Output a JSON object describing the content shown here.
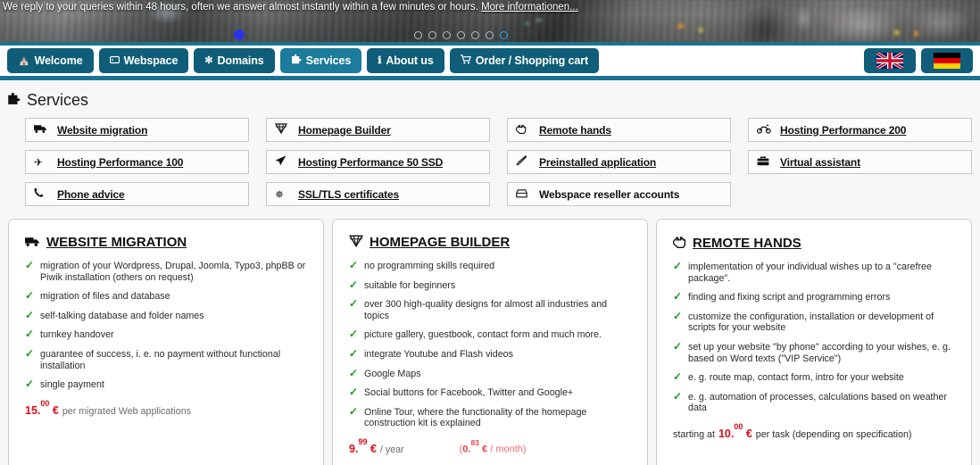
{
  "banner": {
    "message": "We reply to your queries within 48 hours, often we answer almost instantly within a few minutes or hours.",
    "more_link": "More informationen...",
    "carousel": {
      "dot_count": 7,
      "active_index": 6
    }
  },
  "nav": {
    "items": [
      {
        "label": "Welcome",
        "icon": "home-icon",
        "glyph": "⌂",
        "active": false
      },
      {
        "label": "Webspace",
        "icon": "server-icon",
        "glyph": "⛁",
        "active": false
      },
      {
        "label": "Domains",
        "icon": "globe-icon",
        "glyph": "✼",
        "active": false
      },
      {
        "label": "Services",
        "icon": "puzzle-icon",
        "glyph": "✙",
        "active": true
      },
      {
        "label": "About us",
        "icon": "info-icon",
        "glyph": "ℹ",
        "active": false
      },
      {
        "label": "Order / Shopping cart",
        "icon": "shopping-cart-icon",
        "glyph": "Ὥ2",
        "active": false
      }
    ],
    "languages": [
      {
        "name": "english-flag-button",
        "code": "en"
      },
      {
        "name": "german-flag-button",
        "code": "de"
      }
    ]
  },
  "page": {
    "title": "Services",
    "title_icon": "puzzle-icon"
  },
  "service_links": [
    [
      {
        "label": "Website migration",
        "icon": "truck-icon",
        "glyph": "🚚",
        "underline": true
      },
      {
        "label": "Hosting Performance 100",
        "icon": "airplane-icon",
        "glyph": "✈",
        "underline": true
      },
      {
        "label": "Phone advice",
        "icon": "phone-icon",
        "glyph": "☎",
        "underline": true
      }
    ],
    [
      {
        "label": "Homepage Builder",
        "icon": "diamond-icon",
        "glyph": "💎",
        "underline": true
      },
      {
        "label": "Hosting Performance 50 SSD",
        "icon": "rocket-icon",
        "glyph": "➤",
        "underline": true
      },
      {
        "label": "SSL/TLS certificates",
        "icon": "asterisk-icon",
        "glyph": "✵",
        "underline": true
      }
    ],
    [
      {
        "label": "Remote hands",
        "icon": "hand-pointer-icon",
        "glyph": "☚",
        "underline": true
      },
      {
        "label": "Preinstalled application",
        "icon": "pencil-icon",
        "glyph": "✎",
        "underline": true
      },
      {
        "label": "Webspace reseller accounts",
        "icon": "printer-icon",
        "glyph": "⎙",
        "underline": false
      }
    ],
    [
      {
        "label": "Hosting Performance 200",
        "icon": "motorcycle-icon",
        "glyph": "🏍",
        "underline": true
      },
      {
        "label": "Virtual assistant",
        "icon": "briefcase-icon",
        "glyph": "💼",
        "underline": true
      }
    ]
  ],
  "cards": [
    {
      "title": "WEBSITE MIGRATION",
      "icon": "truck-icon",
      "glyph": "🚚",
      "features": [
        "migration of your Wordpress, Drupal, Joomla, Typo3, phpBB or Piwik installation (others on request)",
        "migration of files and database",
        "self-talking database and folder names",
        "turnkey handover",
        "guarantee of success, i. e. no payment without functional installation",
        "single payment"
      ],
      "price": {
        "lead": "",
        "whole": "15.",
        "cents": "00",
        "currency": "€",
        "unit": "per migrated Web applications",
        "sub": null
      }
    },
    {
      "title": "HOMEPAGE BUILDER",
      "icon": "diamond-icon",
      "glyph": "💎",
      "features": [
        "no programming skills required",
        "suitable for beginners",
        "over 300 high-quality designs for almost all industries and topics",
        "picture gallery, guestbook, contact form and much more.",
        "integrate Youtube and Flash videos",
        "Google Maps",
        "Social buttons for Facebook, Twitter and Google+",
        "Online Tour, where the functionality of the homepage construction kit is explained"
      ],
      "price": {
        "lead": "",
        "whole": "9.",
        "cents": "99",
        "currency": "€",
        "unit": "/ year",
        "sub": {
          "open": "(",
          "whole": "0.",
          "cents": "83",
          "currency": "€",
          "unit": "/ month",
          "close": ")"
        }
      }
    },
    {
      "title": "REMOTE HANDS",
      "icon": "hand-pointer-icon",
      "glyph": "☚",
      "features": [
        "implementation of your individual wishes up to a \"carefree package\".",
        "finding and fixing script and programming errors",
        "customize the configuration, installation or development of scripts for your website",
        "set up your website \"by phone\" according to your wishes, e. g. based on Word texts (\"VIP Service\")",
        "e. g. route map, contact form, intro for your website",
        "e. g. automation of processes, calculations based on weather data"
      ],
      "price": {
        "lead": "starting at",
        "whole": "10.",
        "cents": "00",
        "currency": "€",
        "unit": "per task (depending on specification)",
        "sub": null
      }
    }
  ],
  "colors": {
    "nav_button": "#0f5d78",
    "nav_button_active": "#1d7b9c",
    "nav_strip": "#1b7391",
    "check_green": "#1a9a1a",
    "price_red": "#e00b15",
    "price_sub_red": "#f06a72",
    "page_bg": "#f7f7f7",
    "card_bg": "#ffffff",
    "card_border": "#cdcdcd"
  }
}
